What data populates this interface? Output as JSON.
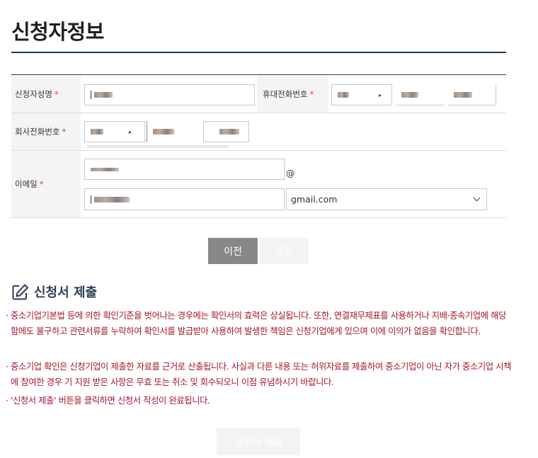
{
  "page": {
    "title": "신청자정보"
  },
  "form": {
    "name_label": "신청자성명",
    "mobile_label": "휴대전화번호",
    "company_phone_label": "회사전화번호",
    "email_label": "이메일",
    "required_mark": "*",
    "at_sign": "@",
    "email_domain_selected": "gmail.com"
  },
  "buttons": {
    "prev": "이전",
    "save": "저장",
    "submit": "신청서 제출"
  },
  "section": {
    "title": "신청서 제출",
    "icon": "edit-icon"
  },
  "notices": [
    {
      "bullet": "·",
      "text": "중소기업기본법 등에 의한 확인기준을 벗어나는 경우에는 확인서의 효력은 상실됩니다. 또한, 연결재무제표를 사용하거나 지배·종속기업에 해당함에도 불구하고 관련서류를 누락하여 확인서를 발급받아 사용하여 발생한 책임은 신청기업에게 있으며 이에 이의가 없음을 확인합니다."
    },
    {
      "bullet": "·",
      "text": "중소기업 확인은 신청기업이 제출한 자료를 근거로 산출됩니다. 사실과 다른 내용 또는 허위자료를 제출하여 중소기업이 아닌 자가 중소기업 시책에 참여한 경우 기 지원 받은 사항은 무효 또는 취소 및 회수되오니 이점 유념하시기 바랍니다."
    },
    {
      "bullet": "·",
      "text": "'신청서 제출' 버튼을 클릭하면 신청서 작성이 완료됩니다."
    }
  ],
  "colors": {
    "title_rule": "#1e3a5a",
    "required": "#e8461c",
    "notice": "#a4162a",
    "prev_button": "#888888",
    "section_title": "#2c3d57"
  }
}
